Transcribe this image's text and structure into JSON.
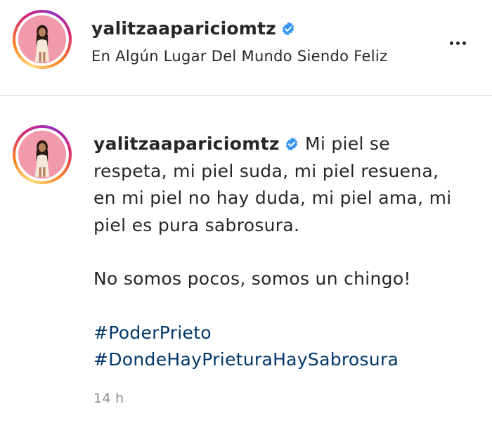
{
  "post_header": {
    "username": "yalitzaapariciomtz",
    "location": "En Algún Lugar Del Mundo Siendo Feliz",
    "more_icon": "more-horizontal-icon"
  },
  "caption": {
    "username": "yalitzaapariciomtz",
    "text_line1": "Mi piel se respeta, mi piel suda, mi piel resuena, en mi piel no hay duda, mi piel ama, mi piel es pura sabrosura.",
    "text_line2": "No somos pocos, somos un chingo!",
    "hashtags": [
      "#PoderPrieto",
      "#DondeHayPrieturaHaySabrosura"
    ],
    "timestamp": "14 h"
  },
  "colors": {
    "text": "#262626",
    "hashtag": "#00376b",
    "verified": "#3897f0",
    "muted": "#8e8e8e",
    "divider": "#dbdbdb"
  }
}
